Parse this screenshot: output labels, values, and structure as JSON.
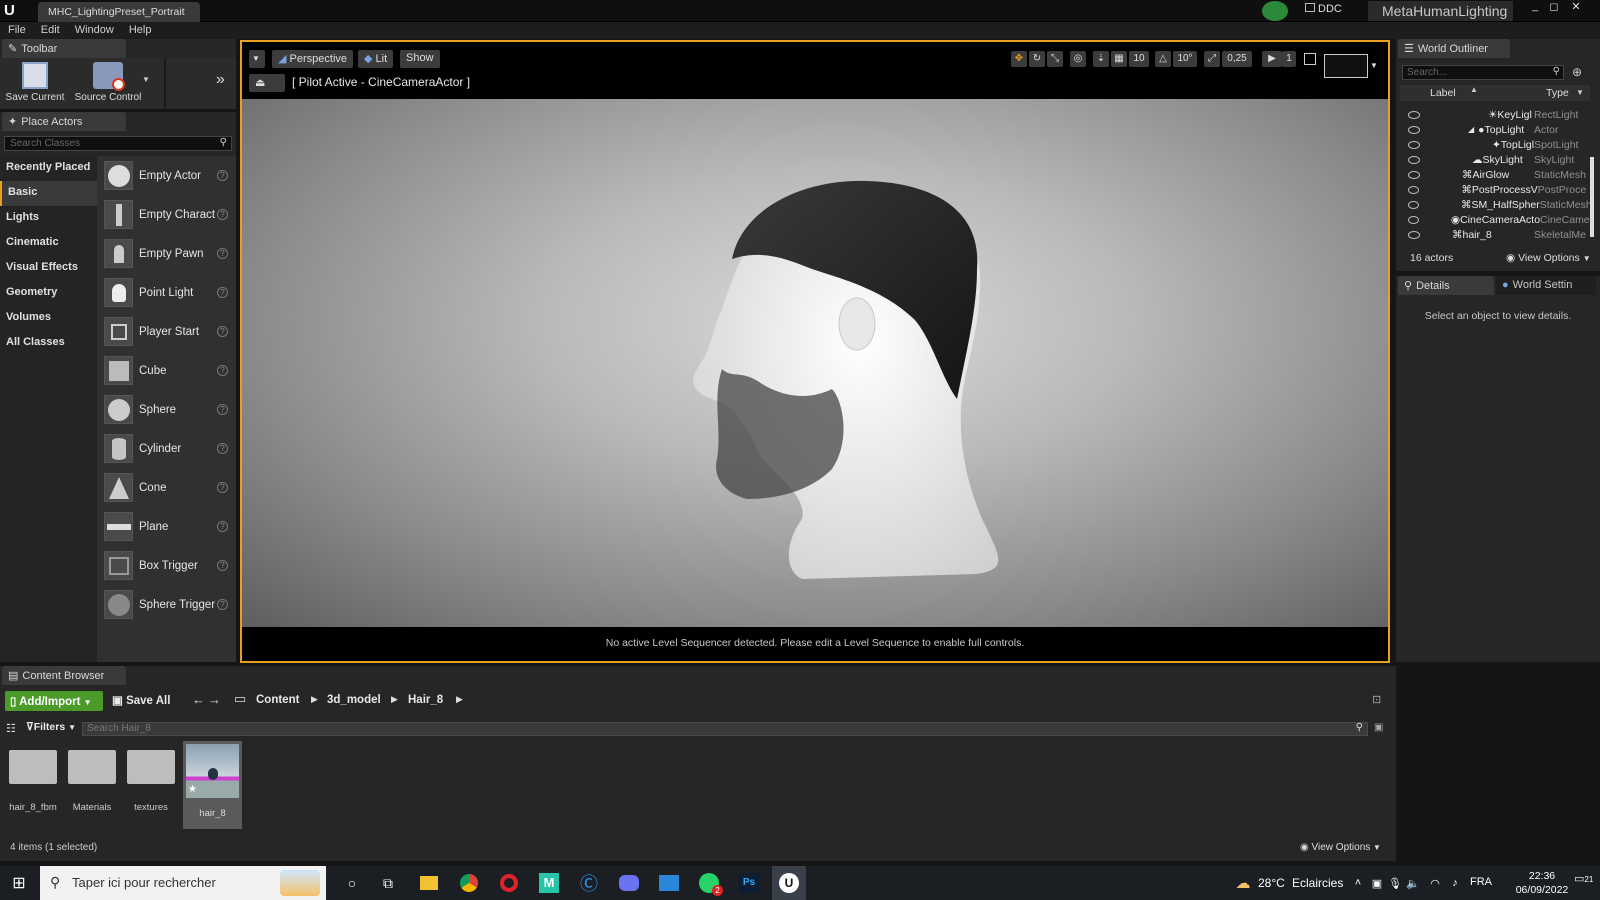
{
  "app": {
    "logo": "U",
    "doc_tab": "MHC_LightingPreset_Portrait",
    "ddc_label": "DDC",
    "project_name": "MetaHumanLighting"
  },
  "menu": [
    "File",
    "Edit",
    "Window",
    "Help"
  ],
  "toolbar": {
    "title": "Toolbar",
    "save_label": "Save Current",
    "source_control_label": "Source Control"
  },
  "place_actors": {
    "title": "Place Actors",
    "search_placeholder": "Search Classes",
    "categories": [
      "Recently Placed",
      "Basic",
      "Lights",
      "Cinematic",
      "Visual Effects",
      "Geometry",
      "Volumes",
      "All Classes"
    ],
    "selected_category": "Basic",
    "items": [
      "Empty Actor",
      "Empty Charact",
      "Empty Pawn",
      "Point Light",
      "Player Start",
      "Cube",
      "Sphere",
      "Cylinder",
      "Cone",
      "Plane",
      "Box Trigger",
      "Sphere Trigger"
    ]
  },
  "viewport": {
    "perspective": "Perspective",
    "lit": "Lit",
    "show": "Show",
    "pilot": "[ Pilot Active - CineCameraActor ]",
    "grid_snap": "10",
    "rot_snap": "10°",
    "scale_snap": "0,25",
    "camera_speed": "1",
    "footer": "No active Level Sequencer detected. Please edit a Level Sequence to enable full controls."
  },
  "outliner": {
    "title": "World Outliner",
    "search_placeholder": "Search...",
    "col_label": "Label",
    "col_type": "Type",
    "rows": [
      {
        "label": "KeyLigl",
        "type": "RectLight"
      },
      {
        "label": "TopLight",
        "type": "Actor"
      },
      {
        "label": "TopLigl",
        "type": "SpotLight"
      },
      {
        "label": "SkyLight",
        "type": "SkyLight"
      },
      {
        "label": "AirGlow",
        "type": "StaticMesh"
      },
      {
        "label": "PostProcessV",
        "type": "PostProce"
      },
      {
        "label": "SM_HalfSpher",
        "type": "StaticMesh"
      },
      {
        "label": "CineCameraActo",
        "type": "CineCame"
      },
      {
        "label": "hair_8",
        "type": "SkeletalMe"
      }
    ],
    "count": "16 actors",
    "view_options": "View Options"
  },
  "details": {
    "tab_details": "Details",
    "tab_world": "World Settin",
    "empty": "Select an object to view details."
  },
  "content_browser": {
    "title": "Content Browser",
    "add_import": "Add/Import",
    "save_all": "Save All",
    "breadcrumb": [
      "Content",
      "3d_model",
      "Hair_8"
    ],
    "filters": "Filters",
    "search_placeholder": "Search Hair_8",
    "assets": [
      "hair_8_fbm",
      "Materials",
      "textures",
      "hair_8"
    ],
    "status": "4 items (1 selected)",
    "view_options": "View Options"
  },
  "taskbar": {
    "search_placeholder": "Taper ici pour rechercher",
    "temperature": "28°C",
    "weather": "Eclaircies",
    "lang": "FRA",
    "time": "22:36",
    "date": "06/09/2022",
    "notif_count": "21",
    "whatsapp_badge": "2",
    "ps_label": "Ps",
    "meta_label": "M"
  },
  "colors": {
    "accent": "#e8a020",
    "add_import_green": "#4c9a2a",
    "selected_asset": "#5a5a5a"
  }
}
